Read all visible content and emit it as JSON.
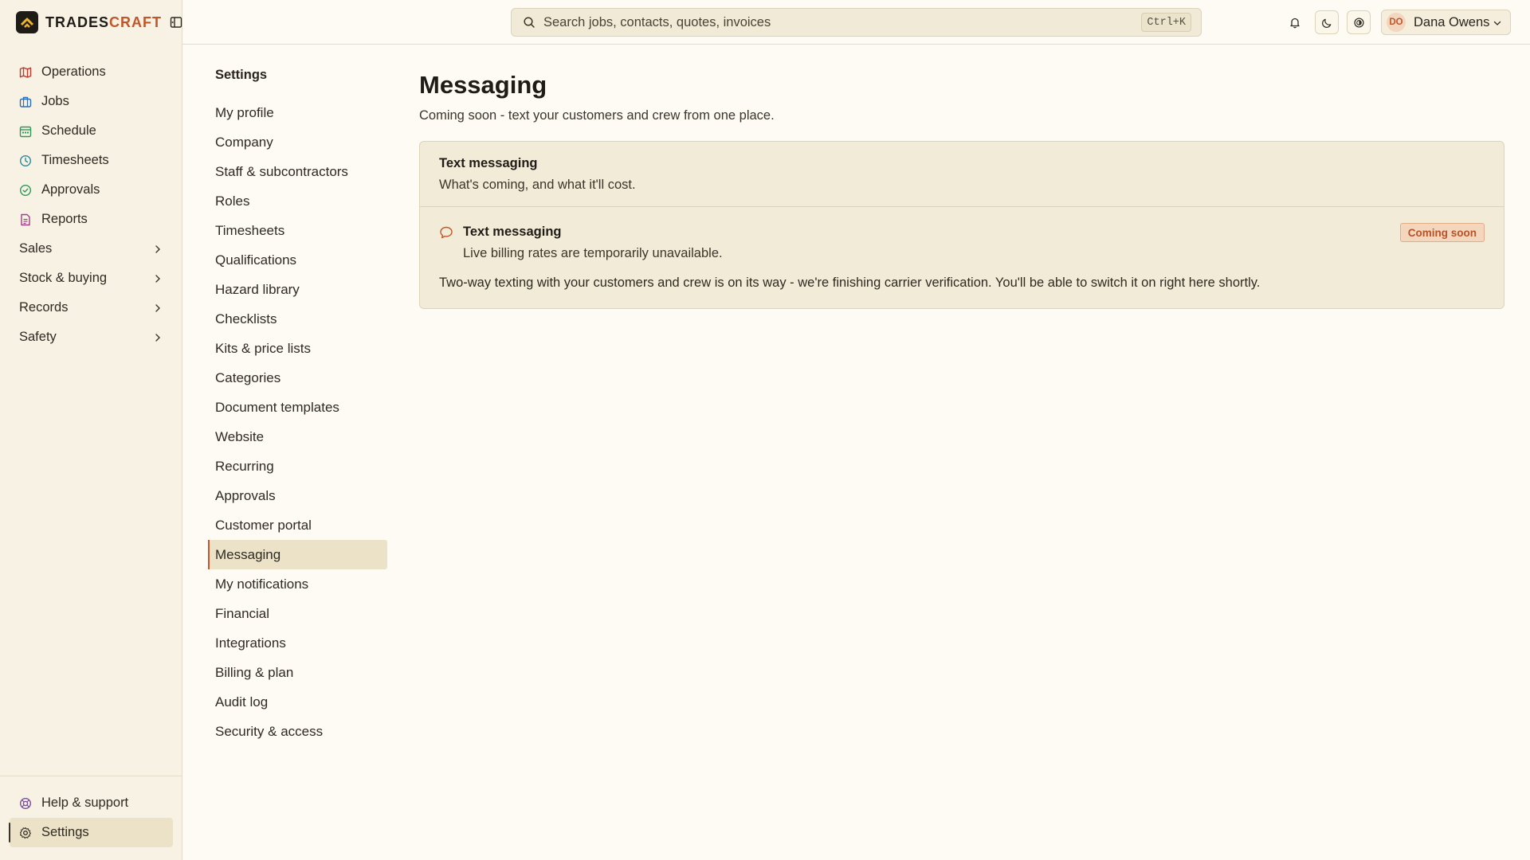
{
  "brand": {
    "name_main": "TRADES",
    "name_accent": "CRAFT",
    "accent_color": "#c0572b"
  },
  "app_nav": {
    "items": [
      {
        "label": "Operations",
        "icon": "map-icon",
        "color": "#c0392b"
      },
      {
        "label": "Jobs",
        "icon": "briefcase-icon",
        "color": "#2f6fb5"
      },
      {
        "label": "Schedule",
        "icon": "calendar-icon",
        "color": "#2e9a5a"
      },
      {
        "label": "Timesheets",
        "icon": "clock-icon",
        "color": "#2a8a9a"
      },
      {
        "label": "Approvals",
        "icon": "check-circle-icon",
        "color": "#2e9a5a"
      },
      {
        "label": "Reports",
        "icon": "document-icon",
        "color": "#a23d8a"
      }
    ],
    "groups": [
      "Sales",
      "Stock & buying",
      "Records",
      "Safety"
    ],
    "bottom": [
      {
        "label": "Help & support",
        "icon": "lifebuoy-icon",
        "color": "#7b4fa0"
      },
      {
        "label": "Settings",
        "icon": "gear-icon",
        "color": "#3a3428"
      }
    ]
  },
  "topbar": {
    "search_placeholder": "Search jobs, contacts, quotes, invoices",
    "search_shortcut": "Ctrl+K",
    "user": {
      "initials": "DO",
      "name": "Dana Owens"
    }
  },
  "settings_nav": {
    "title": "Settings",
    "items": [
      "My profile",
      "Company",
      "Staff & subcontractors",
      "Roles",
      "Timesheets",
      "Qualifications",
      "Hazard library",
      "Checklists",
      "Kits & price lists",
      "Categories",
      "Document templates",
      "Website",
      "Recurring",
      "Approvals",
      "Customer portal",
      "Messaging",
      "My notifications",
      "Financial",
      "Integrations",
      "Billing & plan",
      "Audit log",
      "Security & access"
    ],
    "active": "Messaging"
  },
  "main": {
    "title": "Messaging",
    "subtitle": "Coming soon - text your customers and crew from one place.",
    "card": {
      "heading": "Text messaging",
      "description": "What's coming, and what it'll cost.",
      "feature_title": "Text messaging",
      "feature_note": "Live billing rates are temporarily unavailable.",
      "badge": "Coming soon",
      "feature_description": "Two-way texting with your customers and crew is on its way - we're finishing carrier verification. You'll be able to switch it on right here shortly."
    }
  }
}
